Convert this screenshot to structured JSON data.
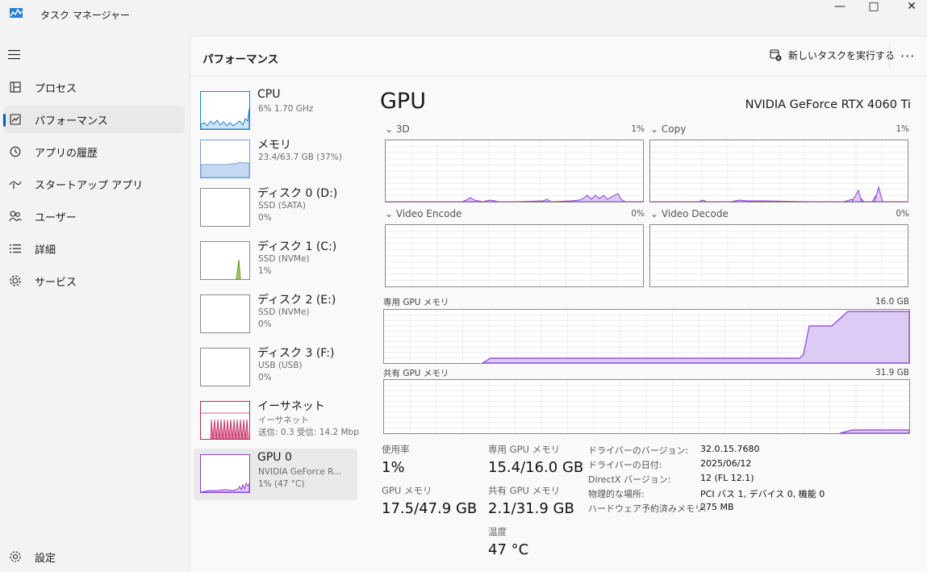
{
  "window": {
    "title": "タスク マネージャー",
    "controls": [
      "—",
      "□",
      "✕"
    ]
  },
  "nav": {
    "items": [
      {
        "label": "プロセス",
        "icon": "processes-icon"
      },
      {
        "label": "パフォーマンス",
        "icon": "performance-icon",
        "active": true
      },
      {
        "label": "アプリの履歴",
        "icon": "app-history-icon"
      },
      {
        "label": "スタートアップ アプリ",
        "icon": "startup-apps-icon"
      },
      {
        "label": "ユーザー",
        "icon": "users-icon"
      },
      {
        "label": "詳細",
        "icon": "details-icon"
      },
      {
        "label": "サービス",
        "icon": "services-icon"
      }
    ],
    "settings_label": "設定"
  },
  "header": {
    "title": "パフォーマンス",
    "run_task_label": "新しいタスクを実行する",
    "more": "···"
  },
  "devices": [
    {
      "name": "CPU",
      "line1": "6%  1.70 GHz",
      "line2": ""
    },
    {
      "name": "メモリ",
      "line1": "23.4/63.7 GB (37%)",
      "line2": ""
    },
    {
      "name": "ディスク 0 (D:)",
      "line1": "SSD (SATA)",
      "line2": "0%"
    },
    {
      "name": "ディスク 1 (C:)",
      "line1": "SSD (NVMe)",
      "line2": "1%"
    },
    {
      "name": "ディスク 2 (E:)",
      "line1": "SSD (NVMe)",
      "line2": "0%"
    },
    {
      "name": "ディスク 3 (F:)",
      "line1": "USB (USB)",
      "line2": "0%"
    },
    {
      "name": "イーサネット",
      "line1": "イーサネット",
      "line2": "送信: 0.3  受信: 14.2 Mbps"
    },
    {
      "name": "GPU 0",
      "line1": "NVIDIA GeForce R...",
      "line2": "1%  (47 °C)",
      "selected": true
    }
  ],
  "gpu": {
    "title": "GPU",
    "model": "NVIDIA GeForce RTX 4060 Ti",
    "engines": [
      {
        "label": "3D",
        "pct": "1%"
      },
      {
        "label": "Copy",
        "pct": "1%"
      },
      {
        "label": "Video Encode",
        "pct": "0%"
      },
      {
        "label": "Video Decode",
        "pct": "0%"
      }
    ],
    "dedicated_label": "専用 GPU メモリ",
    "dedicated_max": "16.0 GB",
    "shared_label": "共有 GPU メモリ",
    "shared_max": "31.9 GB",
    "stats": {
      "usage_label": "使用率",
      "usage": "1%",
      "ded_label": "専用 GPU メモリ",
      "ded": "15.4/16.0 GB",
      "gpumem_label": "GPU メモリ",
      "gpumem": "17.5/47.9 GB",
      "shared_label": "共有 GPU メモリ",
      "shared": "2.1/31.9 GB",
      "temp_label": "温度",
      "temp": "47 °C"
    },
    "info": [
      {
        "k": "ドライバーのバージョン:",
        "v": "32.0.15.7680"
      },
      {
        "k": "ドライバーの日付:",
        "v": "2025/06/12"
      },
      {
        "k": "DirectX バージョン:",
        "v": "12 (FL 12.1)"
      },
      {
        "k": "物理的な場所:",
        "v": "PCI バス 1, デバイス 0, 機能 0"
      },
      {
        "k": "ハードウェア予約済みメモリ:",
        "v": "275 MB"
      }
    ]
  },
  "colors": {
    "accent": "#005fb8",
    "gpu": "#8e3fd6",
    "gpu_fill": "#dccbf5",
    "cpu": "#1b83c8",
    "memory": "#6f9fd8",
    "disk": "#5b9a17",
    "ethernet": "#c4245d"
  }
}
